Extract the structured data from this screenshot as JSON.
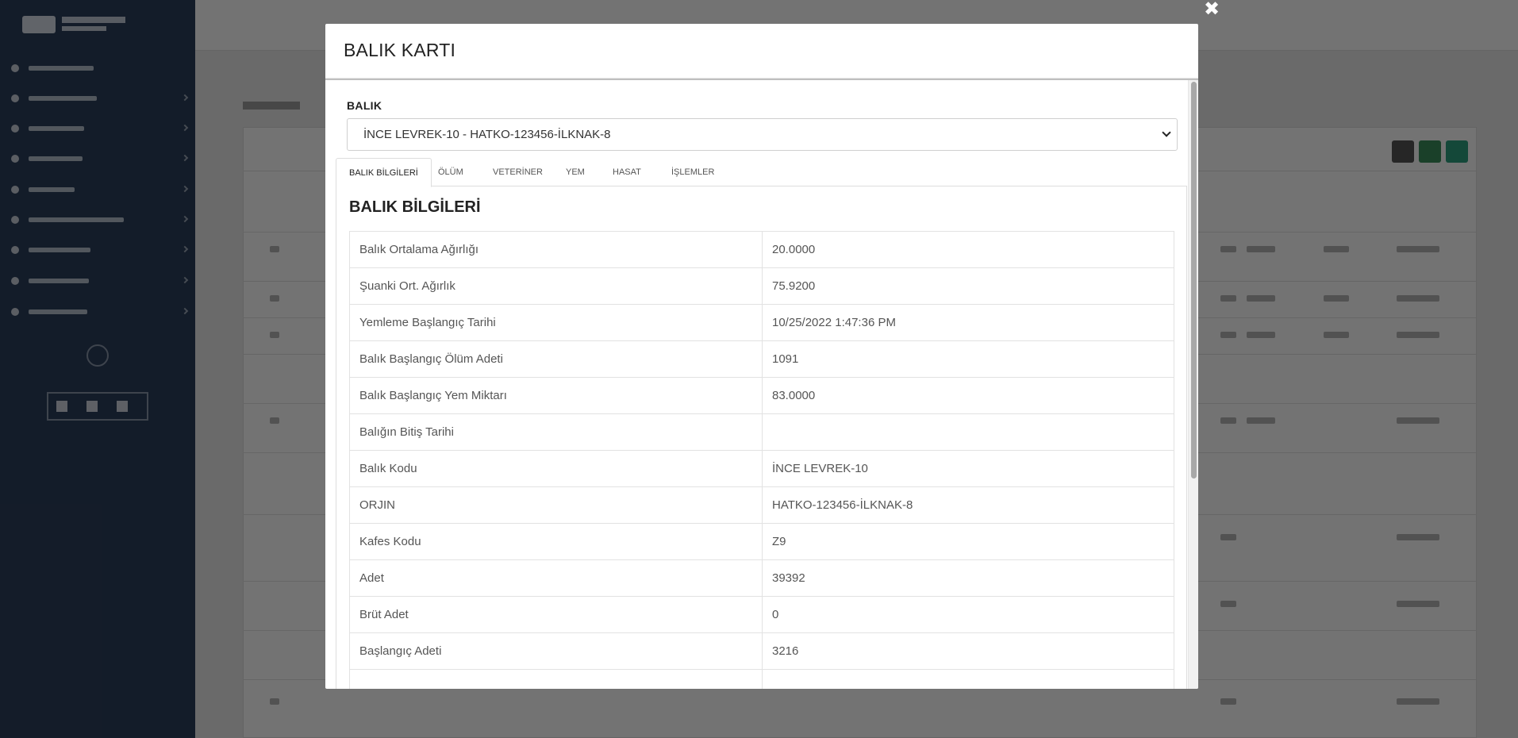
{
  "modal": {
    "title": "BALIK KARTI",
    "close_symbol": "✖",
    "select_label": "BALIK",
    "select_value": "İNCE LEVREK-10 - HATKO-123456-İLKNAK-8",
    "tabs": [
      {
        "label": "BALIK BİLGİLERİ",
        "active": true
      },
      {
        "label": "ÖLÜM",
        "active": false
      },
      {
        "label": "VETERİNER",
        "active": false
      },
      {
        "label": "YEM",
        "active": false
      },
      {
        "label": "HASAT",
        "active": false
      },
      {
        "label": "İŞLEMLER",
        "active": false
      }
    ],
    "panel_title": "BALIK BİLGİLERİ",
    "rows": [
      {
        "key": "Balık Ortalama Ağırlığı",
        "value": "20.0000"
      },
      {
        "key": "Şuanki Ort. Ağırlık",
        "value": "75.9200"
      },
      {
        "key": "Yemleme Başlangıç Tarihi",
        "value": "10/25/2022 1:47:36 PM"
      },
      {
        "key": "Balık Başlangıç Ölüm Adeti",
        "value": "1091"
      },
      {
        "key": "Balık Başlangıç Yem Miktarı",
        "value": "83.0000"
      },
      {
        "key": "Balığın Bitiş Tarihi",
        "value": ""
      },
      {
        "key": "Balık Kodu",
        "value": "İNCE LEVREK-10"
      },
      {
        "key": "ORJIN",
        "value": "HATKO-123456-İLKNAK-8"
      },
      {
        "key": "Kafes Kodu",
        "value": "Z9"
      },
      {
        "key": "Adet",
        "value": "39392"
      },
      {
        "key": "Brüt Adet",
        "value": "0"
      },
      {
        "key": "Başlangıç Adeti",
        "value": "3216"
      }
    ]
  },
  "colors": {
    "sidebar": "#2c3e5c",
    "overlay": "rgba(0,0,0,0.55)",
    "modal_bg": "#ffffff"
  }
}
